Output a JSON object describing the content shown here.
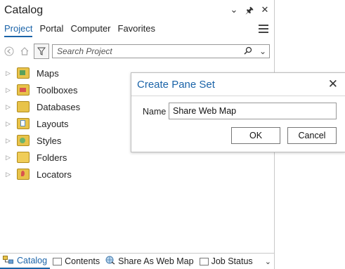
{
  "pane": {
    "title": "Catalog",
    "title_icons": [
      "chevron-down",
      "pin",
      "close"
    ],
    "tabs": [
      {
        "label": "Project",
        "active": true
      },
      {
        "label": "Portal"
      },
      {
        "label": "Computer"
      },
      {
        "label": "Favorites"
      }
    ],
    "search": {
      "placeholder": "Search Project"
    },
    "tree": [
      {
        "label": "Maps",
        "icon": "maps-icon",
        "color": "#c9a227"
      },
      {
        "label": "Toolboxes",
        "icon": "toolbox-icon",
        "color": "#d9534f"
      },
      {
        "label": "Databases",
        "icon": "database-icon",
        "color": "#e0b43a"
      },
      {
        "label": "Layouts",
        "icon": "layout-icon",
        "color": "#d6a92f"
      },
      {
        "label": "Styles",
        "icon": "styles-icon",
        "color": "#d4a22a"
      },
      {
        "label": "Folders",
        "icon": "folder-icon",
        "color": "#e8c34a"
      },
      {
        "label": "Locators",
        "icon": "locator-icon",
        "color": "#d4a22a"
      }
    ]
  },
  "bottom_tabs": [
    {
      "label": "Catalog",
      "active": true
    },
    {
      "label": "Contents"
    },
    {
      "label": "Share As Web Map"
    },
    {
      "label": "Job Status"
    }
  ],
  "dialog": {
    "title": "Create Pane Set",
    "name_label": "Name",
    "name_value": "Share Web Map",
    "ok_label": "OK",
    "cancel_label": "Cancel"
  },
  "colors": {
    "accent": "#1a63a8"
  }
}
